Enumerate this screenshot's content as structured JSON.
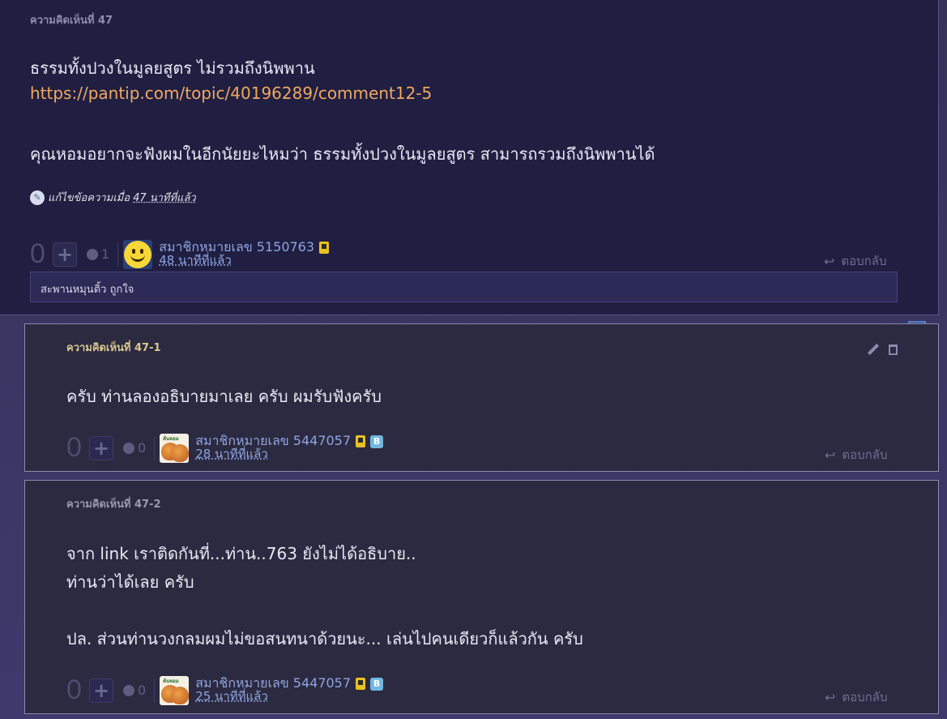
{
  "main_comment": {
    "number": "ความคิดเห็นที่ 47",
    "lines": [
      "ธรรมทั้งปวงในมูลยสูตร ไม่รวมถึงนิพพาน",
      "คุณหอมอยากจะฟังผมในอีกนัยยะไหมว่า ธรรมทั้งปวงในมูลยสูตร สามารถรวมถึงนิพพานได้"
    ],
    "link": "https://pantip.com/topic/40196289/comment12-5",
    "edit_prefix": "แก้ไขข้อความเมื่อ",
    "edit_time": "47 นาทีที่แล้ว",
    "score": "0",
    "emotion_count": "1",
    "username": "สมาชิกหมายเลข 5150763",
    "time": "48 นาทีที่แล้ว",
    "reply_label": "ตอบกลับ",
    "reactions": "สะพานหมุนติ้ว ถูกใจ",
    "avatar_icon": "smiley-avatar-icon"
  },
  "sub_comments": [
    {
      "number": "ความคิดเห็นที่ 47-1",
      "lines": [
        "ครับ ท่านลองอธิบายมาเลย ครับ ผมรับฟังครับ"
      ],
      "score": "0",
      "emotion_count": "0",
      "username": "สมาชิกหมายเลข 5447057",
      "time": "28 นาทีที่แล้ว",
      "reply_label": "ตอบกลับ",
      "badge_b": "B"
    },
    {
      "number": "ความคิดเห็นที่ 47-2",
      "lines": [
        "จาก link เราติดกันที่...ท่าน..763  ยังไม่ได้อธิบาย..",
        "ท่านว่าได้เลย ครับ",
        "ปล. ส่วนท่านวงกลมผมไม่ขอสนทนาด้วยนะ... เล่นไปคนเดียวก็แล้วกัน ครับ"
      ],
      "score": "0",
      "emotion_count": "0",
      "username": "สมาชิกหมายเลข 5447057",
      "time": "25 นาทีที่แล้ว",
      "reply_label": "ตอบกลับ",
      "badge_b": "B"
    }
  ],
  "avatar_label": "ต้นหอม"
}
